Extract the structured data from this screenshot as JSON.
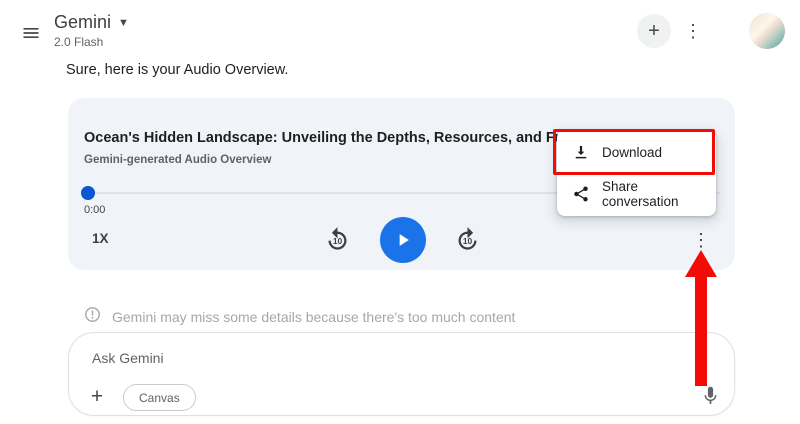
{
  "header": {
    "app_name": "Gemini",
    "model": "2.0 Flash"
  },
  "assistant_message": "Sure, here is your Audio Overview.",
  "audio_player": {
    "title": "Ocean's Hidden Landscape: Unveiling the Depths, Resources, and Futur",
    "subtitle": "Gemini-generated Audio Overview",
    "elapsed_time": "0:00",
    "playback_speed": "1X",
    "skip_back_label": "10",
    "skip_forward_label": "10"
  },
  "context_menu": {
    "items": [
      {
        "label": "Download",
        "icon": "download-icon"
      },
      {
        "label": "Share conversation",
        "icon": "share-icon"
      }
    ]
  },
  "notice_text": "Gemini may miss some details because there's too much content",
  "composer": {
    "placeholder": "Ask Gemini",
    "canvas_chip": "Canvas"
  },
  "colors": {
    "accent_blue": "#1a73e8",
    "slider_blue": "#0b57d0",
    "annotation_red": "#f20b07",
    "card_background": "#f0f4f9"
  }
}
